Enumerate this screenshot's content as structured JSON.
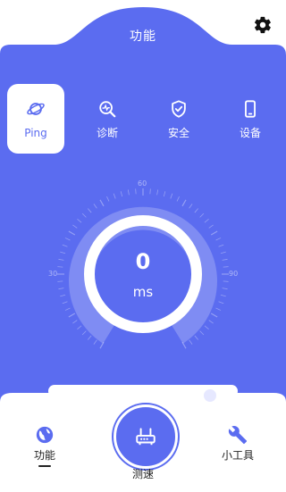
{
  "colors": {
    "primary": "#5b6cf0",
    "white": "#ffffff",
    "text_dark": "#222222"
  },
  "header": {
    "title": "功能",
    "settings_icon": "gear-icon"
  },
  "tabs": [
    {
      "label": "Ping",
      "icon": "planet-icon",
      "active": true
    },
    {
      "label": "诊断",
      "icon": "diagnose-icon",
      "active": false
    },
    {
      "label": "安全",
      "icon": "shield-icon",
      "active": false
    },
    {
      "label": "设备",
      "icon": "phone-icon",
      "active": false
    }
  ],
  "gauge": {
    "value": "0",
    "unit": "ms",
    "scale_labels": [
      "60",
      "30",
      "90"
    ]
  },
  "bottom_nav": {
    "function": {
      "label": "功能",
      "icon": "globe-icon"
    },
    "speed": {
      "label": "测速",
      "icon": "router-icon"
    },
    "tools": {
      "label": "小工具",
      "icon": "wrench-icon"
    }
  }
}
